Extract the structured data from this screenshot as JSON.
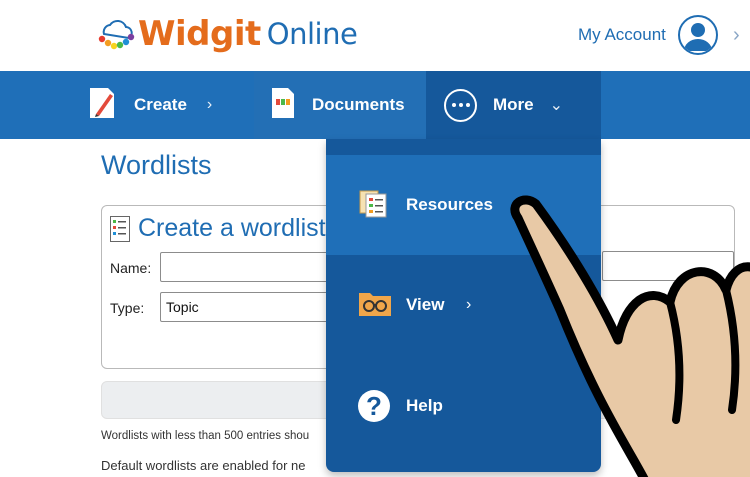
{
  "header": {
    "logo_brand": "Widgit",
    "logo_product": "Online",
    "account_label": "My Account",
    "chevron": "›"
  },
  "nav": {
    "items": [
      {
        "label": "Create",
        "icon": "document-pencil-icon",
        "chevron": "›"
      },
      {
        "label": "Documents",
        "icon": "document-icon"
      },
      {
        "label": "More",
        "icon": "ellipsis-circle-icon",
        "chevron": "⌄"
      }
    ]
  },
  "page": {
    "title": "Wordlists",
    "card_title": "Create a wordlist",
    "name_label": "Name:",
    "name_value": "",
    "type_label": "Type:",
    "type_value": "Topic",
    "note_1": "Wordlists with less than 500 entries shou",
    "note_2": "Default wordlists are enabled for ne"
  },
  "dropdown": {
    "items": [
      {
        "label": "Resources",
        "icon": "resources-icon"
      },
      {
        "label": "View",
        "icon": "glasses-folder-icon",
        "chevron": "›"
      },
      {
        "label": "Help",
        "icon": "help-icon"
      }
    ]
  },
  "colors": {
    "brand_orange": "#e46c1c",
    "brand_blue": "#1f6db3",
    "nav_bg": "#1f6fb8",
    "dropdown_bg": "#15589b"
  }
}
